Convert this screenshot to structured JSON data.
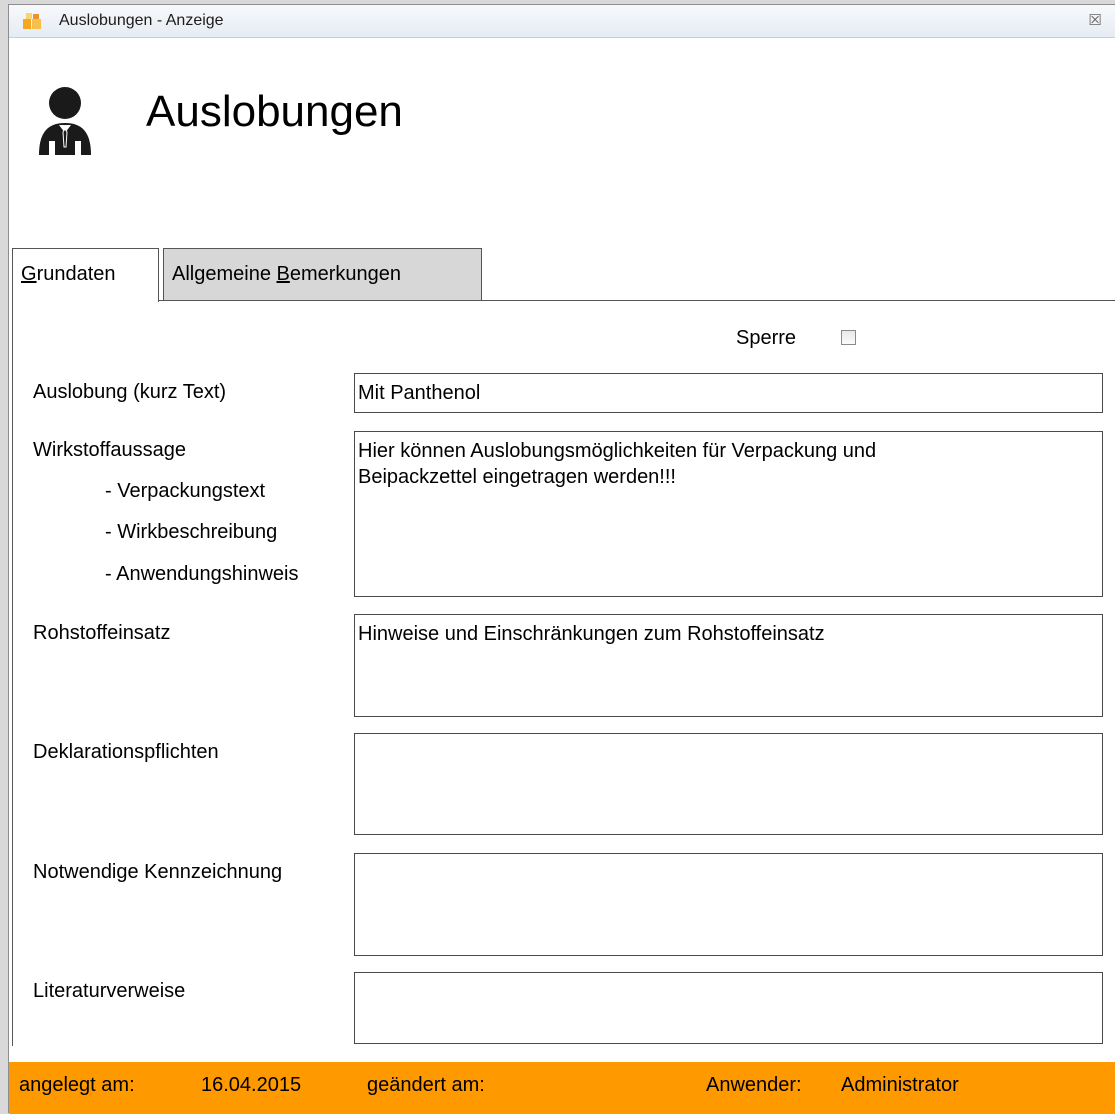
{
  "window": {
    "title": "Auslobungen - Anzeige",
    "close_glyph": "☒"
  },
  "header": {
    "title": "Auslobungen",
    "icon": "user-business-icon"
  },
  "tabs": {
    "grundaten": {
      "pre": "",
      "accel": "G",
      "post": "rundaten"
    },
    "bemerkungen": {
      "pre": "Allgemeine ",
      "accel": "B",
      "post": "emerkungen"
    }
  },
  "form": {
    "sperre_label": "Sperre",
    "sperre_checked": false,
    "auslobung_label": "Auslobung (kurz Text)",
    "auslobung_value": "Mit Panthenol",
    "wirkstoff_label": "Wirkstoffaussage",
    "wirkstoff_sub1": "- Verpackungstext",
    "wirkstoff_sub2": "- Wirkbeschreibung",
    "wirkstoff_sub3": "- Anwendungshinweis",
    "wirkstoff_value": "Hier können Auslobungsmöglichkeiten für Verpackung und\nBeipackzettel eingetragen werden!!!",
    "rohstoff_label": "Rohstoffeinsatz",
    "rohstoff_value": "Hinweise und Einschränkungen zum Rohstoffeinsatz",
    "deklaration_label": "Deklarationspflichten",
    "deklaration_value": "",
    "kennzeichnung_label": "Notwendige Kennzeichnung",
    "kennzeichnung_value": "",
    "literatur_label": "Literaturverweise",
    "literatur_value": ""
  },
  "status": {
    "created_label": "angelegt am:",
    "created_value": "16.04.2015",
    "changed_label": "geändert am:",
    "changed_value": "",
    "user_label": "Anwender:",
    "user_value": "Administrator",
    "bg_color": "#ff9900"
  }
}
